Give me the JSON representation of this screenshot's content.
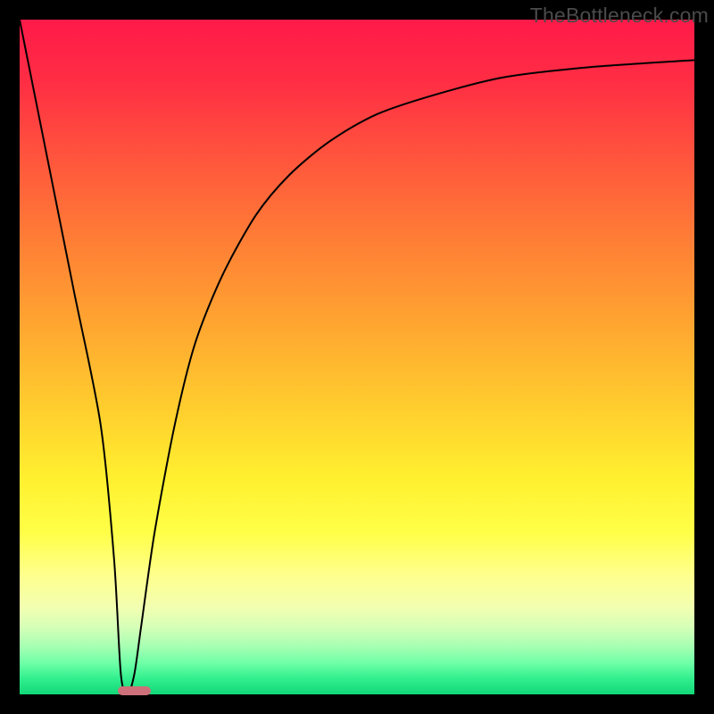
{
  "watermark": "TheBottleneck.com",
  "chart_data": {
    "type": "line",
    "title": "",
    "xlabel": "",
    "ylabel": "",
    "xlim": [
      0,
      100
    ],
    "ylim": [
      0,
      100
    ],
    "grid": false,
    "legend": false,
    "series": [
      {
        "name": "bottleneck-curve",
        "x": [
          0,
          4,
          8,
          12,
          14,
          15,
          16,
          17,
          18,
          20,
          23,
          26,
          30,
          35,
          40,
          46,
          53,
          62,
          72,
          85,
          100
        ],
        "values": [
          100,
          80,
          60,
          40,
          20,
          3,
          0,
          3,
          10,
          24,
          40,
          52,
          62,
          71,
          77,
          82,
          86,
          89,
          91.5,
          93,
          94
        ]
      }
    ],
    "marker": {
      "x_start": 14.5,
      "x_end": 19.5,
      "y": 0
    },
    "gradient_stops": [
      {
        "pos": 0,
        "color": "#ff1a49"
      },
      {
        "pos": 9,
        "color": "#ff2d44"
      },
      {
        "pos": 22,
        "color": "#ff5a3c"
      },
      {
        "pos": 34,
        "color": "#ff8235"
      },
      {
        "pos": 46,
        "color": "#ffa830"
      },
      {
        "pos": 58,
        "color": "#ffcf2e"
      },
      {
        "pos": 68,
        "color": "#fff02f"
      },
      {
        "pos": 76,
        "color": "#ffff47"
      },
      {
        "pos": 82,
        "color": "#ffff8a"
      },
      {
        "pos": 87,
        "color": "#f3ffb0"
      },
      {
        "pos": 90,
        "color": "#d6ffb8"
      },
      {
        "pos": 93,
        "color": "#a4ffb2"
      },
      {
        "pos": 95.5,
        "color": "#6bffa6"
      },
      {
        "pos": 97.5,
        "color": "#35f08f"
      },
      {
        "pos": 100,
        "color": "#11d878"
      }
    ]
  }
}
